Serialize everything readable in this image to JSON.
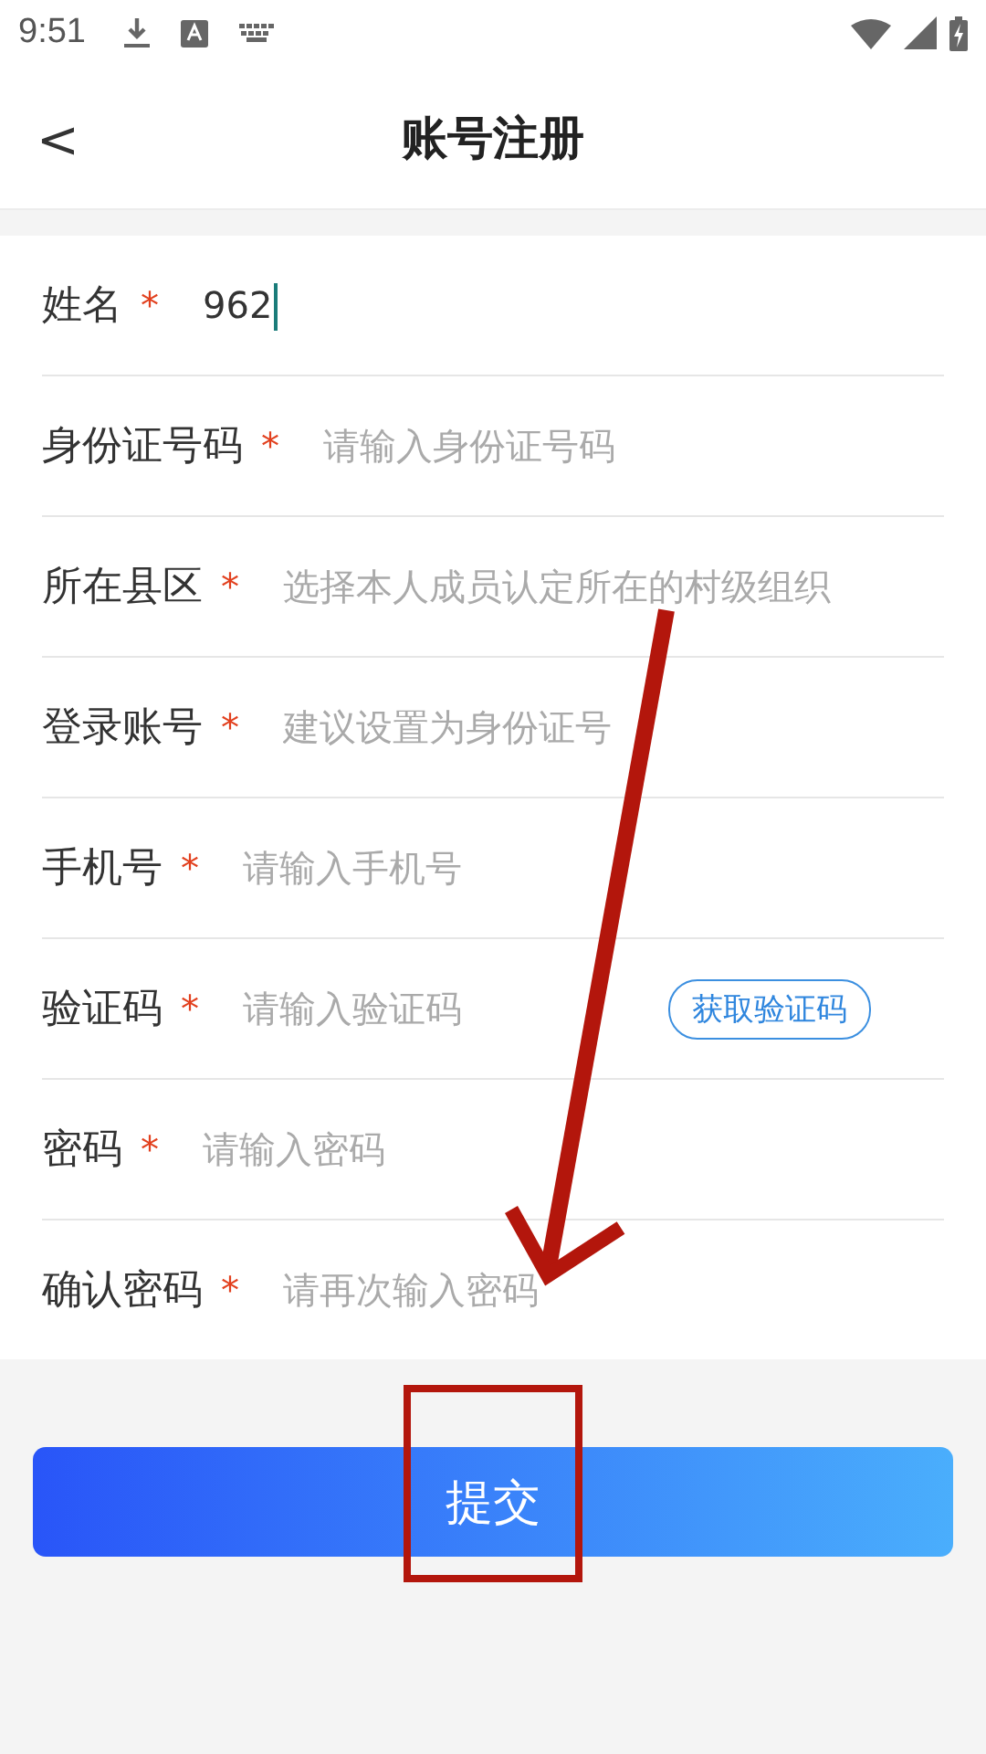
{
  "status_bar": {
    "time": "9:51"
  },
  "header": {
    "back": "<",
    "title": "账号注册"
  },
  "fields": [
    {
      "label": "姓名",
      "required_mark": "*",
      "value": "962",
      "focused": true
    },
    {
      "label": "身份证号码",
      "required_mark": "*",
      "placeholder": "请输入身份证号码"
    },
    {
      "label": "所在县区",
      "required_mark": "*",
      "placeholder": "选择本人成员认定所在的村级组织"
    },
    {
      "label": "登录账号",
      "required_mark": "*",
      "placeholder": "建议设置为身份证号"
    },
    {
      "label": "手机号",
      "required_mark": "*",
      "placeholder": "请输入手机号"
    },
    {
      "label": "验证码",
      "required_mark": "*",
      "placeholder": "请输入验证码",
      "action": "获取验证码"
    },
    {
      "label": "密码",
      "required_mark": "*",
      "placeholder": "请输入密码"
    },
    {
      "label": "确认密码",
      "required_mark": "*",
      "placeholder": "请再次输入密码"
    }
  ],
  "submit": "提交"
}
